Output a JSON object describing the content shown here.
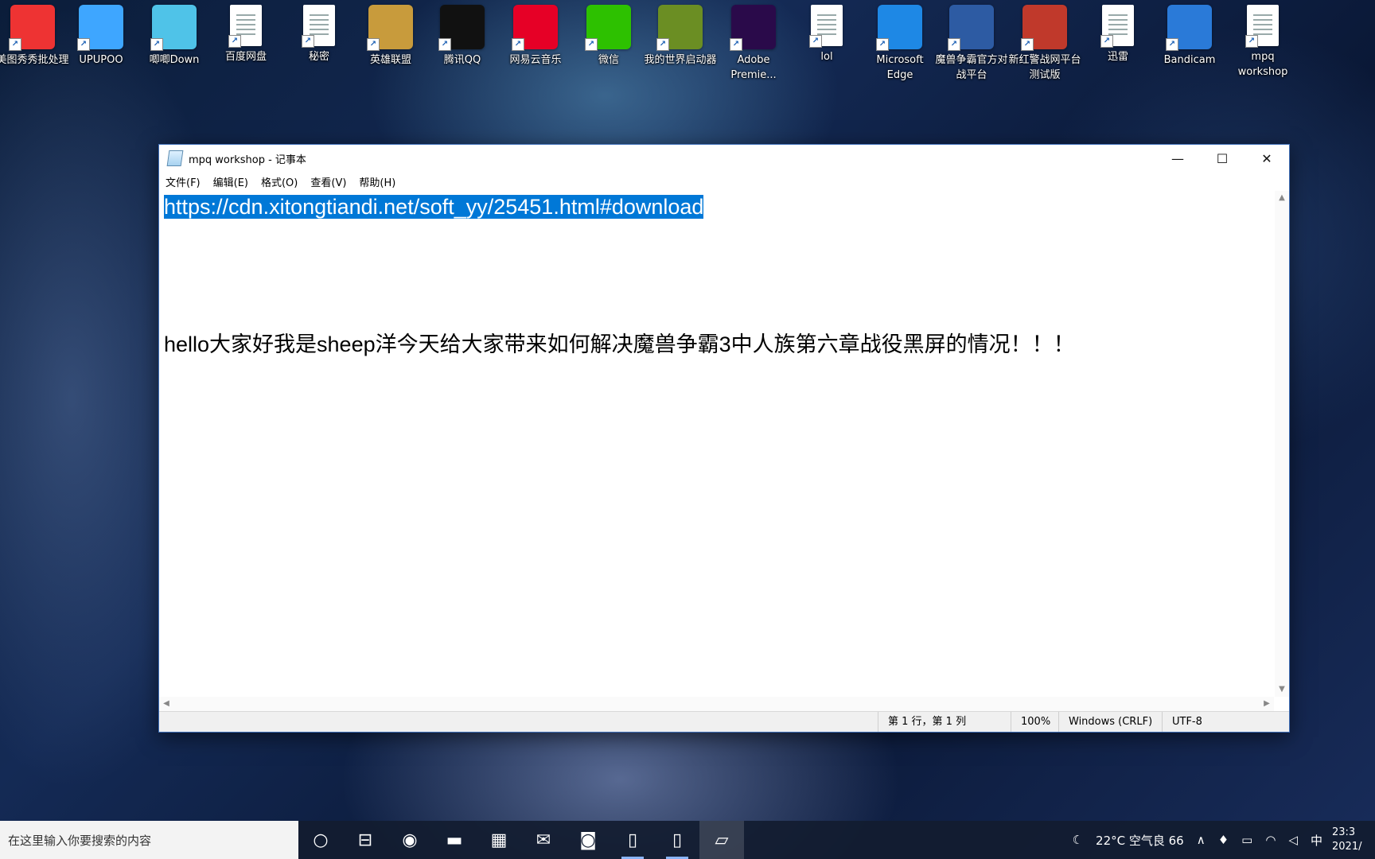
{
  "desktop": {
    "icons": [
      {
        "label": "美图秀秀批处理",
        "color": "#e33"
      },
      {
        "label": "UPUPOO",
        "color": "#3ea6ff"
      },
      {
        "label": "唧唧Down",
        "color": "#4fc3e8"
      },
      {
        "label": "百度网盘",
        "color": "#ffffff"
      },
      {
        "label": "秘密",
        "color": "#ffffff"
      },
      {
        "label": "英雄联盟",
        "color": "#c89b3c"
      },
      {
        "label": "腾讯QQ",
        "color": "#111111"
      },
      {
        "label": "网易云音乐",
        "color": "#e60026"
      },
      {
        "label": "微信",
        "color": "#2dc100"
      },
      {
        "label": "我的世界启动器",
        "color": "#6b8e23"
      },
      {
        "label": "Adobe Premie...",
        "color": "#2a0a4a"
      },
      {
        "label": "lol",
        "color": "#ffffff"
      },
      {
        "label": "Microsoft Edge",
        "color": "#1e88e5"
      },
      {
        "label": "魔兽争霸官方对战平台",
        "color": "#2d5ba3"
      },
      {
        "label": "新红警战网平台测试版",
        "color": "#c0392b"
      },
      {
        "label": "迅雷",
        "color": "#ffffff"
      },
      {
        "label": "Bandicam",
        "color": "#2a7ad8"
      },
      {
        "label": "mpq workshop",
        "color": "#ffffff"
      }
    ]
  },
  "window": {
    "title": "mpq workshop - 记事本",
    "controls": {
      "minimize": "—",
      "maximize": "☐",
      "close": "✕"
    },
    "menu": [
      "文件(F)",
      "编辑(E)",
      "格式(O)",
      "查看(V)",
      "帮助(H)"
    ],
    "content": {
      "url_line": "https://cdn.xitongtiandi.net/soft_yy/25451.html#download",
      "hello_line": "hello大家好我是sheep洋今天给大家带来如何解决魔兽争霸3中人族第六章战役黑屏的情况！！！"
    },
    "status": {
      "position": "第 1 行，第 1 列",
      "zoom": "100%",
      "line_ending": "Windows (CRLF)",
      "encoding": "UTF-8"
    }
  },
  "taskbar": {
    "search_placeholder": "在这里输入你要搜索的内容",
    "apps": [
      {
        "name": "cortana-icon",
        "glyph": "○",
        "state": ""
      },
      {
        "name": "task-view-icon",
        "glyph": "⊟",
        "state": ""
      },
      {
        "name": "edge-taskbar-icon",
        "glyph": "◉",
        "state": ""
      },
      {
        "name": "file-explorer-icon",
        "glyph": "▬",
        "state": ""
      },
      {
        "name": "store-icon",
        "glyph": "▦",
        "state": ""
      },
      {
        "name": "mail-icon",
        "glyph": "✉",
        "state": ""
      },
      {
        "name": "app-taskbar-icon",
        "glyph": "◙",
        "state": ""
      },
      {
        "name": "document-taskbar-icon-1",
        "glyph": "▯",
        "state": "running"
      },
      {
        "name": "document-taskbar-icon-2",
        "glyph": "▯",
        "state": "running"
      },
      {
        "name": "notepad-taskbar-icon",
        "glyph": "▱",
        "state": "active"
      }
    ],
    "tray": {
      "weather": "22°C 空气良 66",
      "ime": "中",
      "time": "23:3",
      "date": "2021/"
    }
  }
}
